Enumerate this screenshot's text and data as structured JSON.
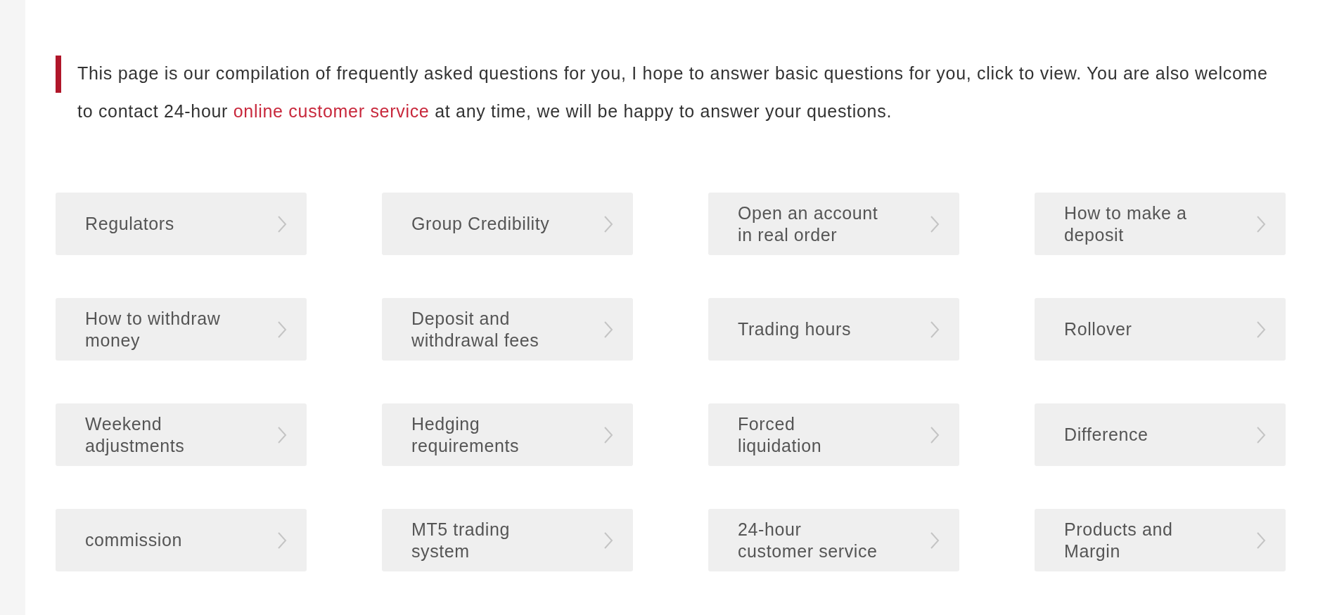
{
  "intro": {
    "before": "This page is our compilation of frequently asked questions for you, I hope to answer basic questions for you, click to view. You are also welcome to contact 24-hour ",
    "link": "online customer service",
    "after": " at any time, we will be happy to answer your questions."
  },
  "faq_items": [
    {
      "label": "Regulators"
    },
    {
      "label": "Group Credibility"
    },
    {
      "label": "Open an account\nin real order"
    },
    {
      "label": "How to make a\ndeposit"
    },
    {
      "label": "How to withdraw\nmoney"
    },
    {
      "label": "Deposit and\nwithdrawal fees"
    },
    {
      "label": "Trading hours"
    },
    {
      "label": "Rollover"
    },
    {
      "label": "Weekend\nadjustments"
    },
    {
      "label": "Hedging\nrequirements"
    },
    {
      "label": "Forced\nliquidation"
    },
    {
      "label": "Difference"
    },
    {
      "label": "commission"
    },
    {
      "label": "MT5 trading\nsystem"
    },
    {
      "label": "24-hour\ncustomer service"
    },
    {
      "label": "Products and\nMargin"
    }
  ]
}
